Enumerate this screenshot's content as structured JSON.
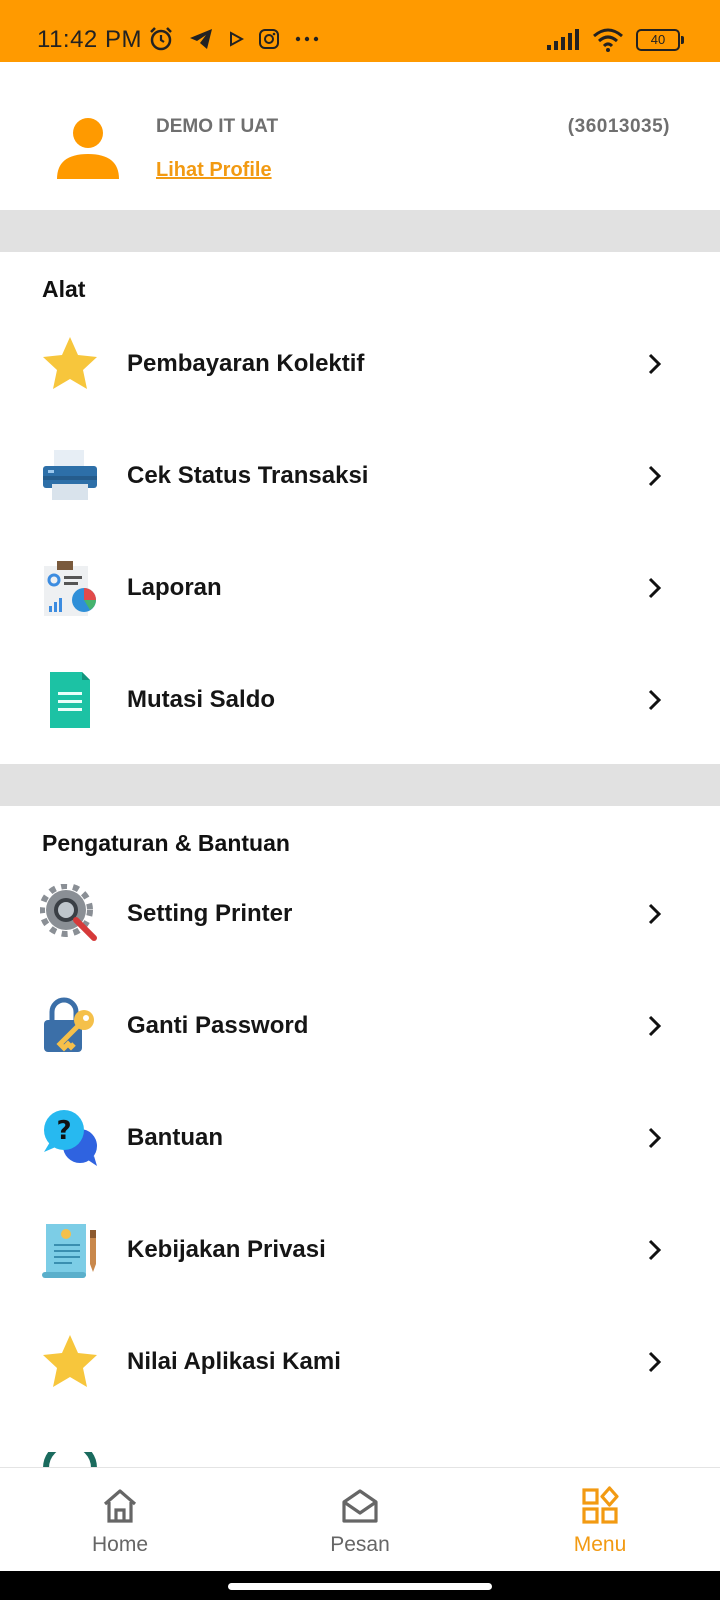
{
  "status_bar": {
    "time": "11:42 PM",
    "battery": "40"
  },
  "profile": {
    "name": "DEMO IT UAT",
    "id": "(36013035)",
    "link": "Lihat Profile"
  },
  "sections": [
    {
      "title": "Alat",
      "items": [
        {
          "label": "Pembayaran Kolektif",
          "icon": "star-icon"
        },
        {
          "label": "Cek Status Transaksi",
          "icon": "printer-icon"
        },
        {
          "label": "Laporan",
          "icon": "report-icon"
        },
        {
          "label": "Mutasi Saldo",
          "icon": "document-icon"
        }
      ]
    },
    {
      "title": "Pengaturan & Bantuan",
      "items": [
        {
          "label": "Setting Printer",
          "icon": "gear-search-icon"
        },
        {
          "label": "Ganti Password",
          "icon": "lock-key-icon"
        },
        {
          "label": "Bantuan",
          "icon": "help-chat-icon"
        },
        {
          "label": "Kebijakan Privasi",
          "icon": "privacy-document-icon"
        },
        {
          "label": "Nilai Aplikasi Kami",
          "icon": "star-icon"
        }
      ]
    }
  ],
  "bottom_nav": [
    {
      "label": "Home",
      "icon": "home-icon"
    },
    {
      "label": "Pesan",
      "icon": "mail-icon"
    },
    {
      "label": "Menu",
      "icon": "menu-grid-icon",
      "active": true
    }
  ],
  "colors": {
    "accent": "#FF9A00",
    "link": "#F29A12",
    "divider": "#E1E1E1"
  }
}
